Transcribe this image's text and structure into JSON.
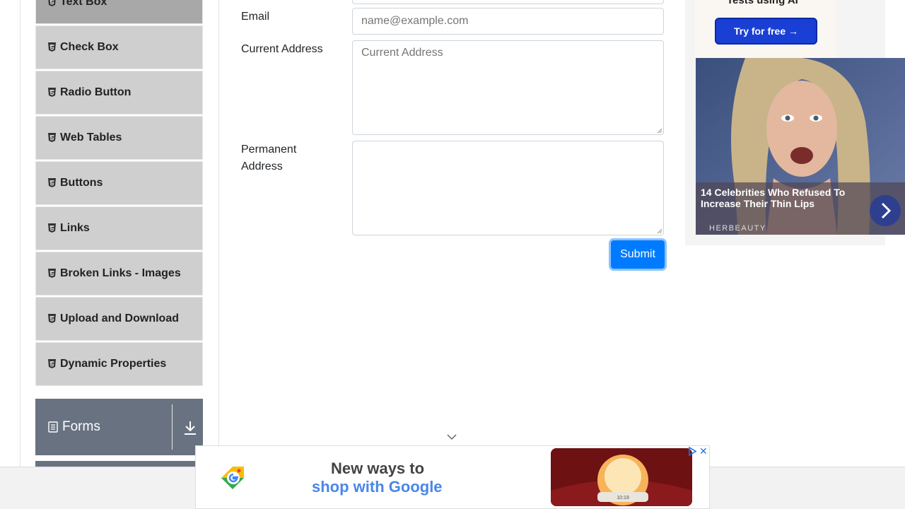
{
  "sidebar": {
    "items": [
      {
        "label": "Text Box",
        "active": true
      },
      {
        "label": "Check Box"
      },
      {
        "label": "Radio Button"
      },
      {
        "label": "Web Tables"
      },
      {
        "label": "Buttons"
      },
      {
        "label": "Links"
      },
      {
        "label": "Broken Links - Images"
      },
      {
        "label": "Upload and Download"
      },
      {
        "label": "Dynamic Properties"
      }
    ],
    "group": {
      "label": "Forms"
    }
  },
  "form": {
    "email": {
      "label": "Email",
      "placeholder": "name@example.com"
    },
    "current_address": {
      "label": "Current Address",
      "placeholder": "Current Address"
    },
    "permanent_address": {
      "label_line1": "Permanent",
      "label_line2": "Address",
      "placeholder": ""
    },
    "submit_label": "Submit"
  },
  "ad_right": {
    "cut_text": "Tests using AI",
    "button_label": "Try for free →",
    "caption": "14 Celebrities Who Refused To Increase Their Thin Lips",
    "brand": "HERBEAUTY"
  },
  "ad_bottom": {
    "line1": "New ways to",
    "line2": "shop with Google",
    "clock_text": "10:19"
  },
  "colors": {
    "primary": "#007bff",
    "group_header": "#687281",
    "menu_bg": "#cfcfcf"
  }
}
